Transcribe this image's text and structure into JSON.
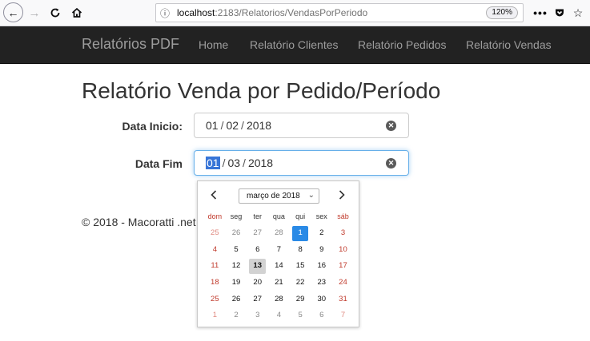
{
  "browser": {
    "url_host": "localhost",
    "url_path": ":2183/Relatorios/VendasPorPeriodo",
    "zoom": "120%",
    "more_glyph": "•••"
  },
  "navbar": {
    "brand": "Relatórios PDF",
    "links": [
      "Home",
      "Relatório Clientes",
      "Relatório Pedidos",
      "Relatório Vendas"
    ]
  },
  "page": {
    "title": "Relatório Venda por Pedido/Período",
    "start_label": "Data Inicio:",
    "start_value": {
      "day": "01",
      "month": "02",
      "year": "2018"
    },
    "end_label": "Data Fim",
    "end_value": {
      "day": "01",
      "month": "03",
      "year": "2018"
    },
    "footer": "© 2018 - Macoratti .net"
  },
  "calendar": {
    "month_label": "março de 2018",
    "weekdays": [
      "dom",
      "seg",
      "ter",
      "qua",
      "qui",
      "sex",
      "sáb"
    ],
    "days": [
      [
        {
          "d": "25",
          "o": true
        },
        {
          "d": "26",
          "o": true
        },
        {
          "d": "27",
          "o": true
        },
        {
          "d": "28",
          "o": true
        },
        {
          "d": "1",
          "s": true
        },
        {
          "d": "2"
        },
        {
          "d": "3"
        }
      ],
      [
        {
          "d": "4"
        },
        {
          "d": "5"
        },
        {
          "d": "6"
        },
        {
          "d": "7"
        },
        {
          "d": "8"
        },
        {
          "d": "9"
        },
        {
          "d": "10"
        }
      ],
      [
        {
          "d": "11"
        },
        {
          "d": "12"
        },
        {
          "d": "13",
          "t": true
        },
        {
          "d": "14"
        },
        {
          "d": "15"
        },
        {
          "d": "16"
        },
        {
          "d": "17"
        }
      ],
      [
        {
          "d": "18"
        },
        {
          "d": "19"
        },
        {
          "d": "20"
        },
        {
          "d": "21"
        },
        {
          "d": "22"
        },
        {
          "d": "23"
        },
        {
          "d": "24"
        }
      ],
      [
        {
          "d": "25"
        },
        {
          "d": "26"
        },
        {
          "d": "27"
        },
        {
          "d": "28"
        },
        {
          "d": "29"
        },
        {
          "d": "30"
        },
        {
          "d": "31"
        }
      ],
      [
        {
          "d": "1",
          "o": true
        },
        {
          "d": "2",
          "o": true
        },
        {
          "d": "3",
          "o": true
        },
        {
          "d": "4",
          "o": true
        },
        {
          "d": "5",
          "o": true
        },
        {
          "d": "6",
          "o": true
        },
        {
          "d": "7",
          "o": true
        }
      ]
    ]
  },
  "colors": {
    "navbar_bg": "#222222",
    "selected_day": "#2a8ae6",
    "weekend": "#c0392b",
    "focus_border": "#66afe9"
  }
}
